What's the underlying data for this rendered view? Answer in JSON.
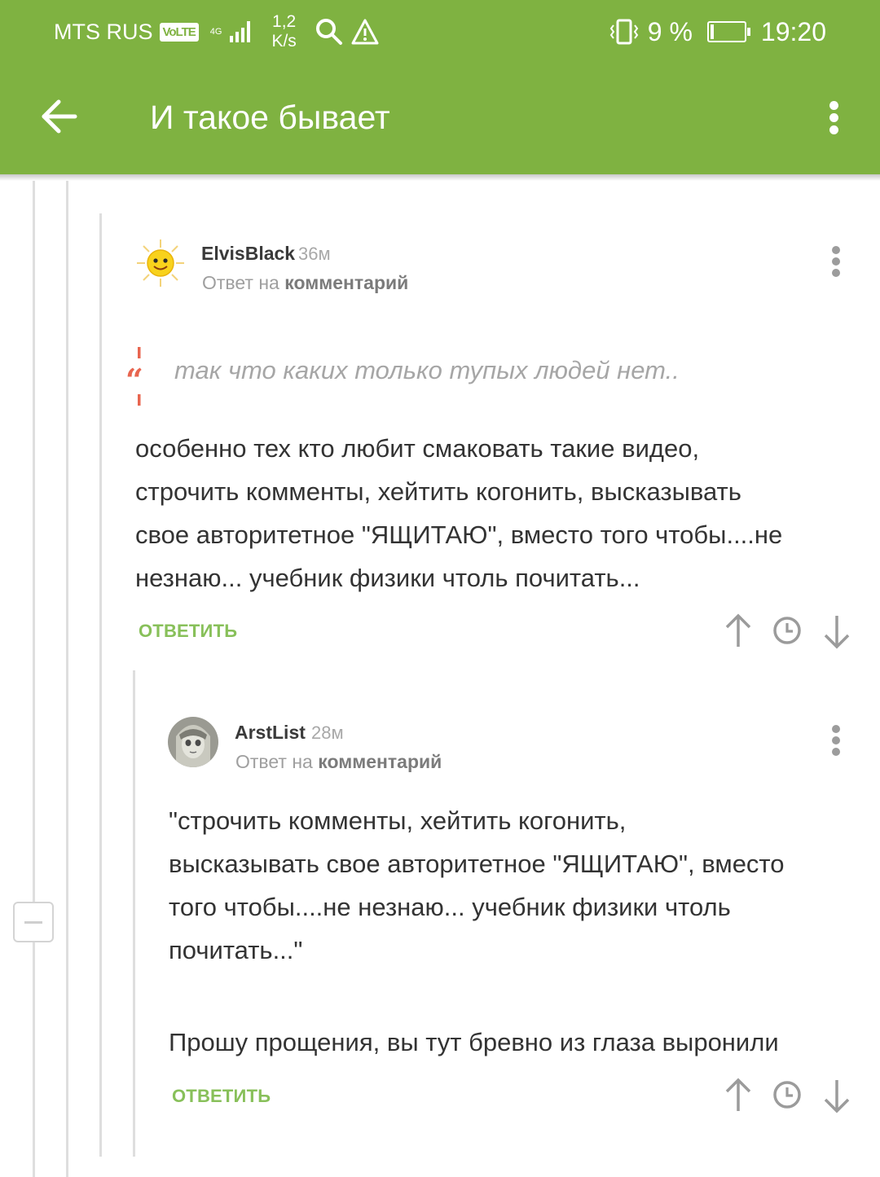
{
  "status_bar": {
    "carrier": "MTS RUS",
    "volte": "VoLTE",
    "network": "4G",
    "speed_value": "1,2",
    "speed_unit": "K/s",
    "battery_percent": "9 %",
    "time": "19:20"
  },
  "app_bar": {
    "title": "И такое бывает",
    "back_icon": "arrow-left-icon",
    "menu_icon": "more-vertical-icon"
  },
  "comments": [
    {
      "author": "ElvisBlack",
      "time": "36м",
      "reply_prefix": "Ответ на",
      "reply_link": "комментарий",
      "quote": "так что каких только тупых людей нет..",
      "lines": [
        "особенно тех кто любит смаковать такие видео,",
        "строчить комменты, хейтить когонить, высказывать",
        "свое авторитетное \"ЯЩИТАЮ\", вместо того чтобы....не",
        "незнаю... учебник физики чтоль почитать..."
      ],
      "reply_label": "ОТВЕТИТЬ"
    },
    {
      "author": "ArstList",
      "time": "28м",
      "reply_prefix": "Ответ на",
      "reply_link": "комментарий",
      "lines": [
        "\"строчить комменты, хейтить когонить,",
        "высказывать свое авторитетное \"ЯЩИТАЮ\", вместо",
        "того чтобы....не незнаю... учебник физики чтоль",
        "почитать...\""
      ],
      "last_line": "Прошу прощения, вы тут бревно из глаза выронили",
      "reply_label": "ОТВЕТИТЬ"
    }
  ],
  "colors": {
    "app_bar": "#7fb241",
    "reply_button": "#88c05a",
    "quote_mark": "#e8654f"
  }
}
